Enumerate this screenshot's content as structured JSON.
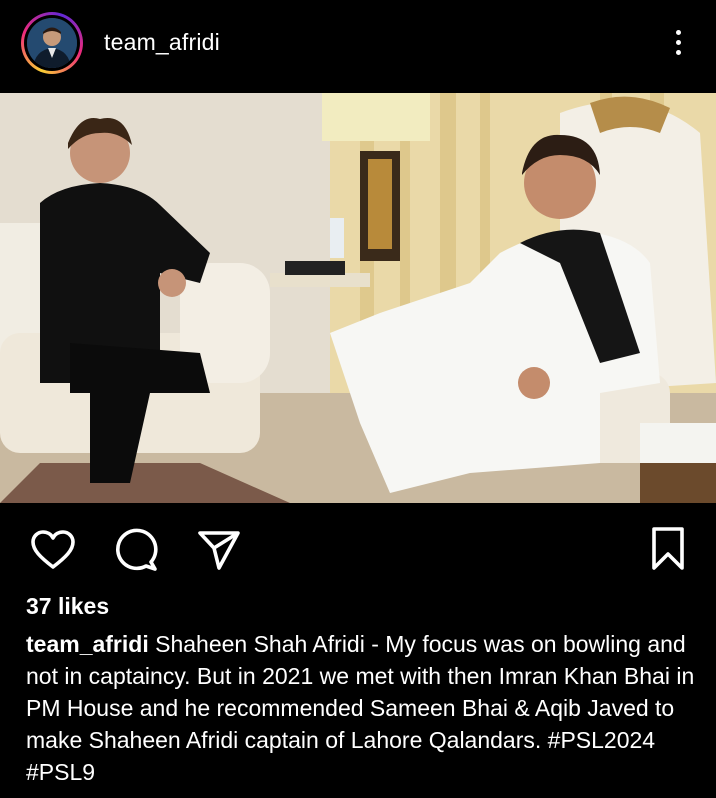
{
  "post": {
    "username": "team_afridi",
    "likes": "37 likes",
    "caption_user": "team_afridi",
    "caption_text": "Shaheen Shah Afridi - My focus was on bowling and not in captaincy. But in 2021 we met with then Imran Khan Bhai in PM House and he recommended Sameen Bhai & Aqib Javed to make Shaheen Afridi captain of Lahore Qalandars.",
    "hashtags": [
      "#PSL2024",
      "#PSL9"
    ]
  },
  "icons": {
    "more": "more-vertical-icon",
    "like": "heart-icon",
    "comment": "comment-icon",
    "share": "send-icon",
    "save": "bookmark-icon"
  },
  "colors": {
    "background": "#000000",
    "text": "#ffffff",
    "story_ring_start": "#f9ce34",
    "story_ring_mid": "#ee2a7b",
    "story_ring_end": "#6228d7"
  }
}
